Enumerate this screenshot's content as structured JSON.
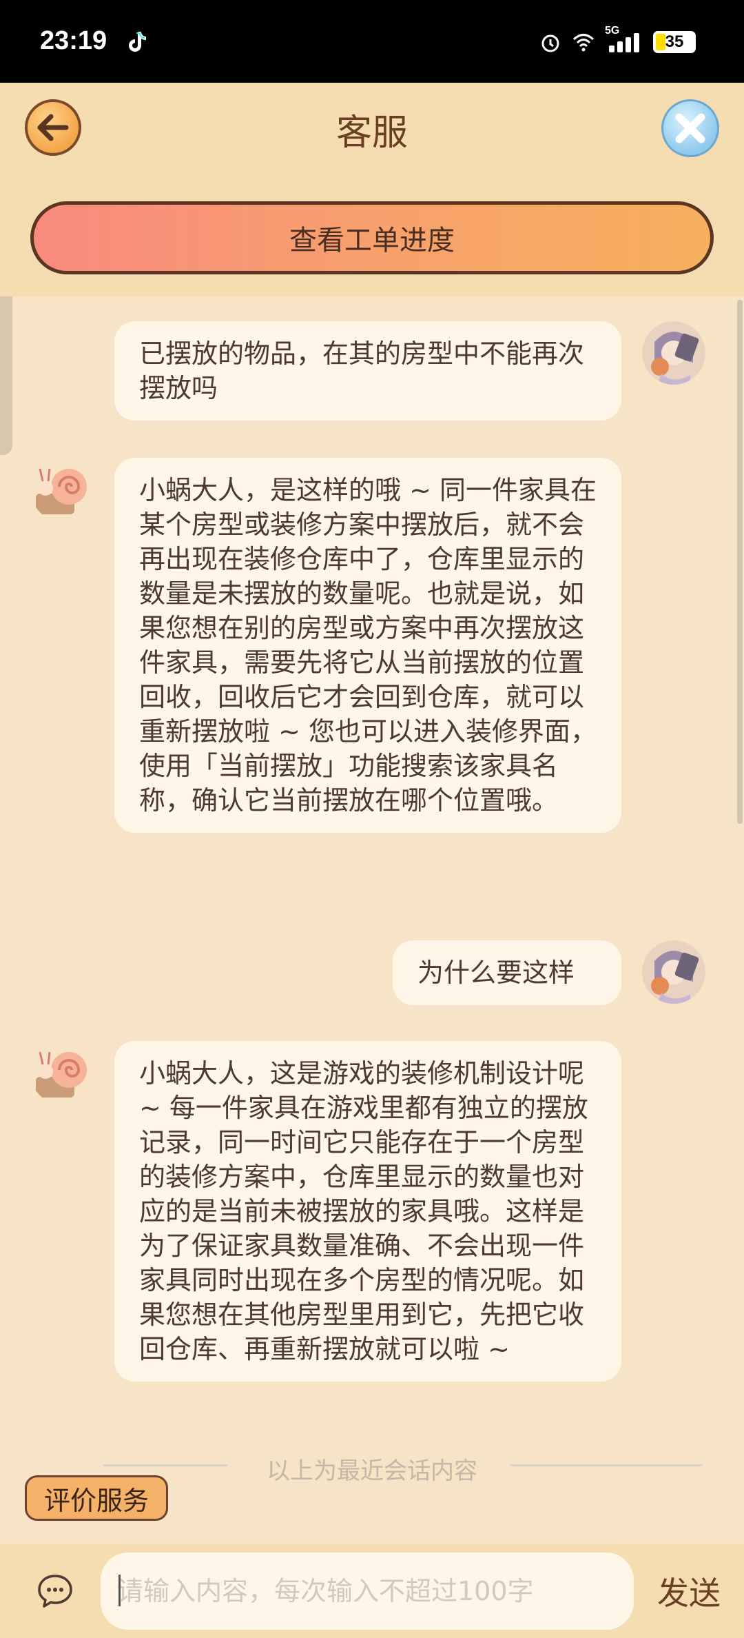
{
  "status_bar": {
    "time": "23:19",
    "network_label": "5G",
    "battery": "35",
    "icons": [
      "tiktok-icon",
      "alarm-icon",
      "wifi-icon",
      "signal-icon",
      "battery-icon"
    ]
  },
  "header": {
    "title": "客服",
    "progress_button": "查看工单进度"
  },
  "messages": [
    {
      "role": "user",
      "text": "已摆放的物品，在其的房型中不能再次摆放吗"
    },
    {
      "role": "agent",
      "text": "小蜗大人，是这样的哦 ~ 同一件家具在某个房型或装修方案中摆放后，就不会再出现在装修仓库中了，仓库里显示的数量是未摆放的数量呢。也就是说，如果您想在别的房型或方案中再次摆放这件家具，需要先将它从当前摆放的位置回收，回收后它才会回到仓库，就可以重新摆放啦 ~ 您也可以进入装修界面，使用「当前摆放」功能搜索该家具名称，确认它当前摆放在哪个位置哦。"
    },
    {
      "role": "user",
      "text": "为什么要这样"
    },
    {
      "role": "agent",
      "text": "小蜗大人，这是游戏的装修机制设计呢 ~ 每一件家具在游戏里都有独立的摆放记录，同一时间它只能存在于一个房型的装修方案中，仓库里显示的数量也对应的是当前未被摆放的家具哦。这样是为了保证家具数量准确、不会出现一件家具同时出现在多个房型的情况呢。如果您想在其他房型里用到它，先把它收回仓库、再重新摆放就可以啦 ~"
    }
  ],
  "divider_text": "以上为最近会话内容",
  "rate_button": "评价服务",
  "input": {
    "placeholder": "请输入内容，每次输入不超过100字",
    "value": "",
    "send_label": "发送"
  },
  "colors": {
    "header_bg": "#f6dcb1",
    "chat_bg": "#f7e4c6",
    "bubble_bg": "#fff6e8",
    "text": "#4b3a2e",
    "accent_brown": "#6a3f25"
  }
}
